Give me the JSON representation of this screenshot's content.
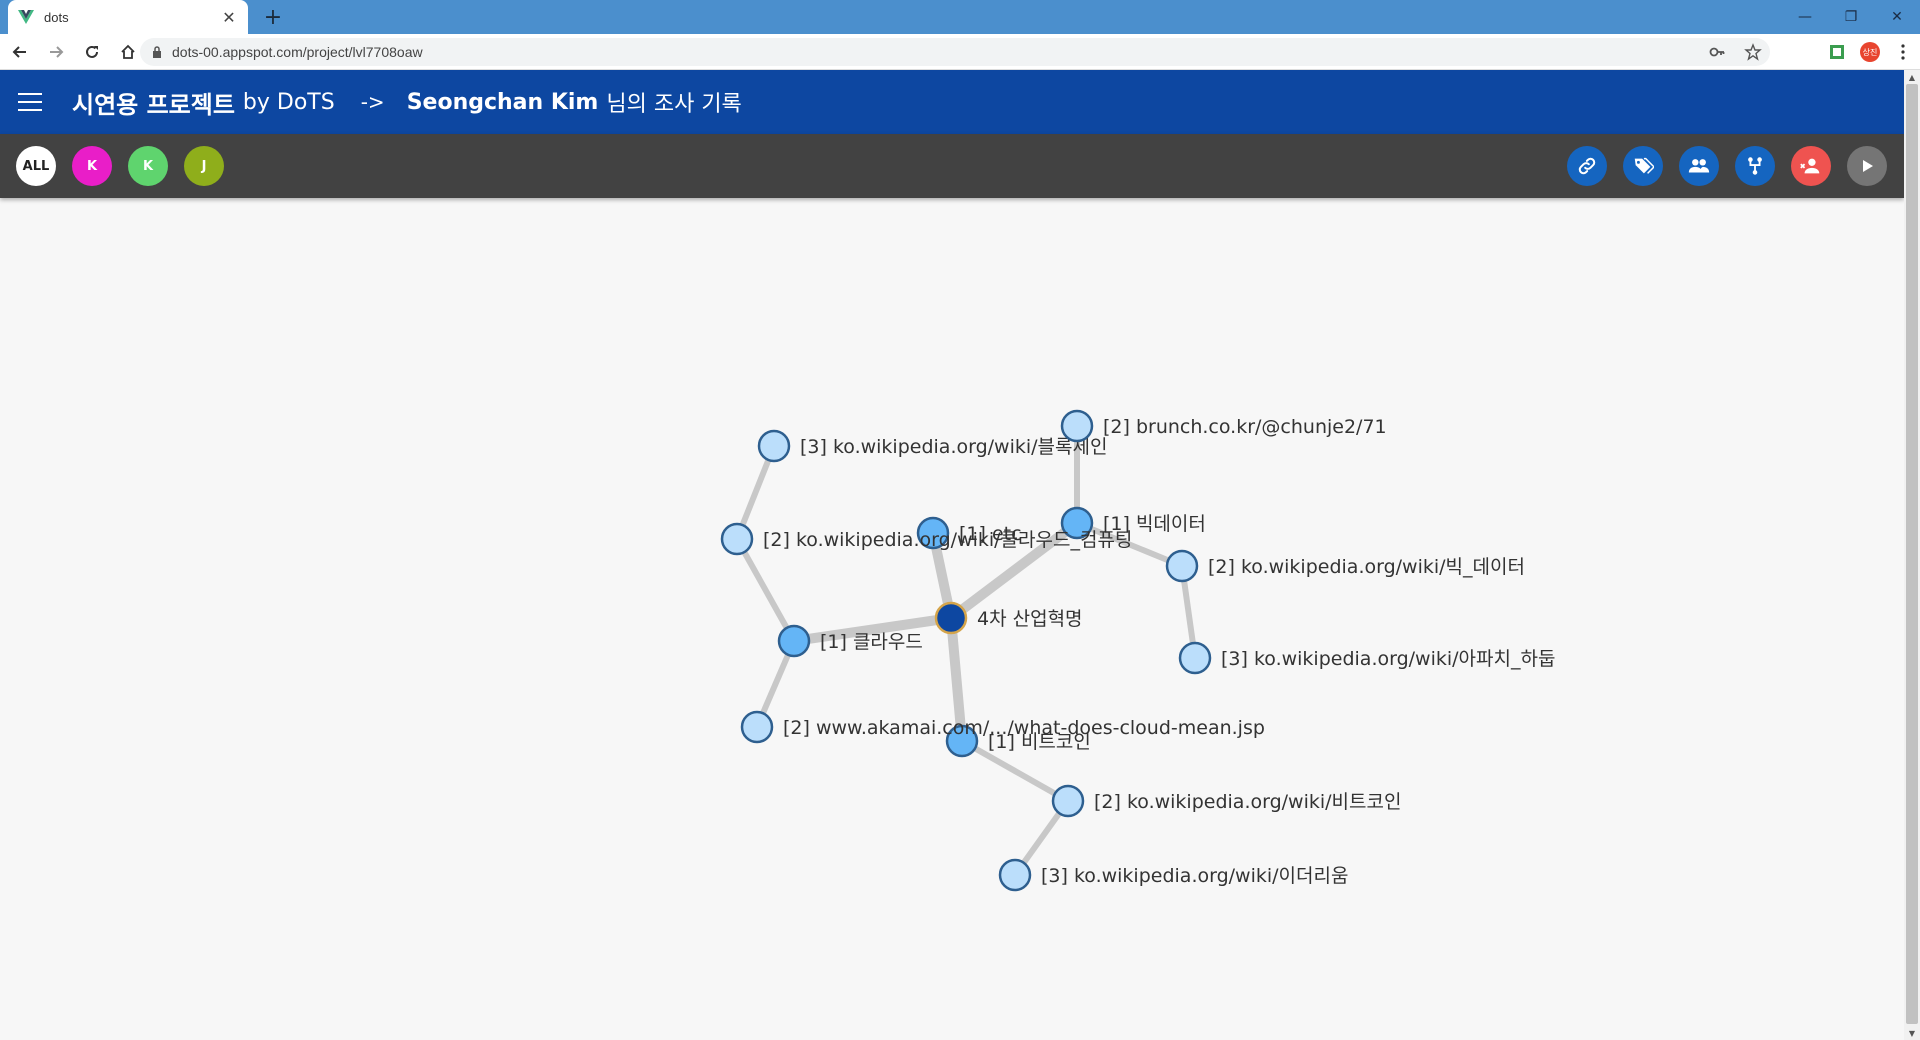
{
  "browser": {
    "tab_title": "dots",
    "url": "dots-00.appspot.com/project/lvl7708oaw",
    "profile_label": "상진"
  },
  "header": {
    "project_title": "시연용 프로젝트",
    "by_label": "by DoTS",
    "arrow": "->",
    "user_name": "Seongchan Kim",
    "suffix": "님의 조사 기록"
  },
  "filters": [
    {
      "label": "ALL",
      "color": "#ffffff"
    },
    {
      "label": "K",
      "color": "#e91ec8"
    },
    {
      "label": "K",
      "color": "#5fd46e"
    },
    {
      "label": "J",
      "color": "#8fae1b"
    }
  ],
  "actions": [
    {
      "name": "link-icon"
    },
    {
      "name": "tags-icon"
    },
    {
      "name": "group-icon"
    },
    {
      "name": "tree-icon"
    },
    {
      "name": "remove-user-icon"
    },
    {
      "name": "play-icon"
    }
  ],
  "graph": {
    "nodes": [
      {
        "id": "root",
        "label": "4차 산업혁명",
        "level": 0
      },
      {
        "id": "cloud",
        "label": "[1] 클라우드",
        "level": 1
      },
      {
        "id": "etc",
        "label": "[1] etc",
        "level": 1
      },
      {
        "id": "bigdata",
        "label": "[1] 빅데이터",
        "level": 1
      },
      {
        "id": "bitcoin",
        "label": "[1] 비트코인",
        "level": 1
      },
      {
        "id": "cloud_wiki",
        "label": "[2] ko.wikipedia.org/wiki/클라우드_컴퓨팅",
        "level": 2
      },
      {
        "id": "blockchain",
        "label": "[3] ko.wikipedia.org/wiki/블록체인",
        "level": 3
      },
      {
        "id": "akamai",
        "label": "[2] www.akamai.com/.../what-does-cloud-mean.jsp",
        "level": 2
      },
      {
        "id": "brunch",
        "label": "[2] brunch.co.kr/@chunje2/71",
        "level": 2
      },
      {
        "id": "bigdata_wiki",
        "label": "[2] ko.wikipedia.org/wiki/빅_데이터",
        "level": 2
      },
      {
        "id": "hadoop",
        "label": "[3] ko.wikipedia.org/wiki/아파치_하둡",
        "level": 3
      },
      {
        "id": "bitcoin_wiki",
        "label": "[2] ko.wikipedia.org/wiki/비트코인",
        "level": 2
      },
      {
        "id": "ethereum",
        "label": "[3] ko.wikipedia.org/wiki/이더리움",
        "level": 3
      }
    ],
    "edges": [
      [
        "root",
        "cloud"
      ],
      [
        "root",
        "etc"
      ],
      [
        "root",
        "bigdata"
      ],
      [
        "root",
        "bitcoin"
      ],
      [
        "cloud",
        "cloud_wiki"
      ],
      [
        "cloud_wiki",
        "blockchain"
      ],
      [
        "cloud",
        "akamai"
      ],
      [
        "bigdata",
        "brunch"
      ],
      [
        "bigdata",
        "bigdata_wiki"
      ],
      [
        "bigdata_wiki",
        "hadoop"
      ],
      [
        "bitcoin",
        "bitcoin_wiki"
      ],
      [
        "bitcoin_wiki",
        "ethereum"
      ]
    ],
    "colors": {
      "level0": "#0d47a1",
      "level1": "#64b5f6",
      "level2": "#bbdefb",
      "stroke": "#2e5f8f",
      "edge": "#c8c8c8",
      "root_stroke": "#d4a44a"
    }
  }
}
